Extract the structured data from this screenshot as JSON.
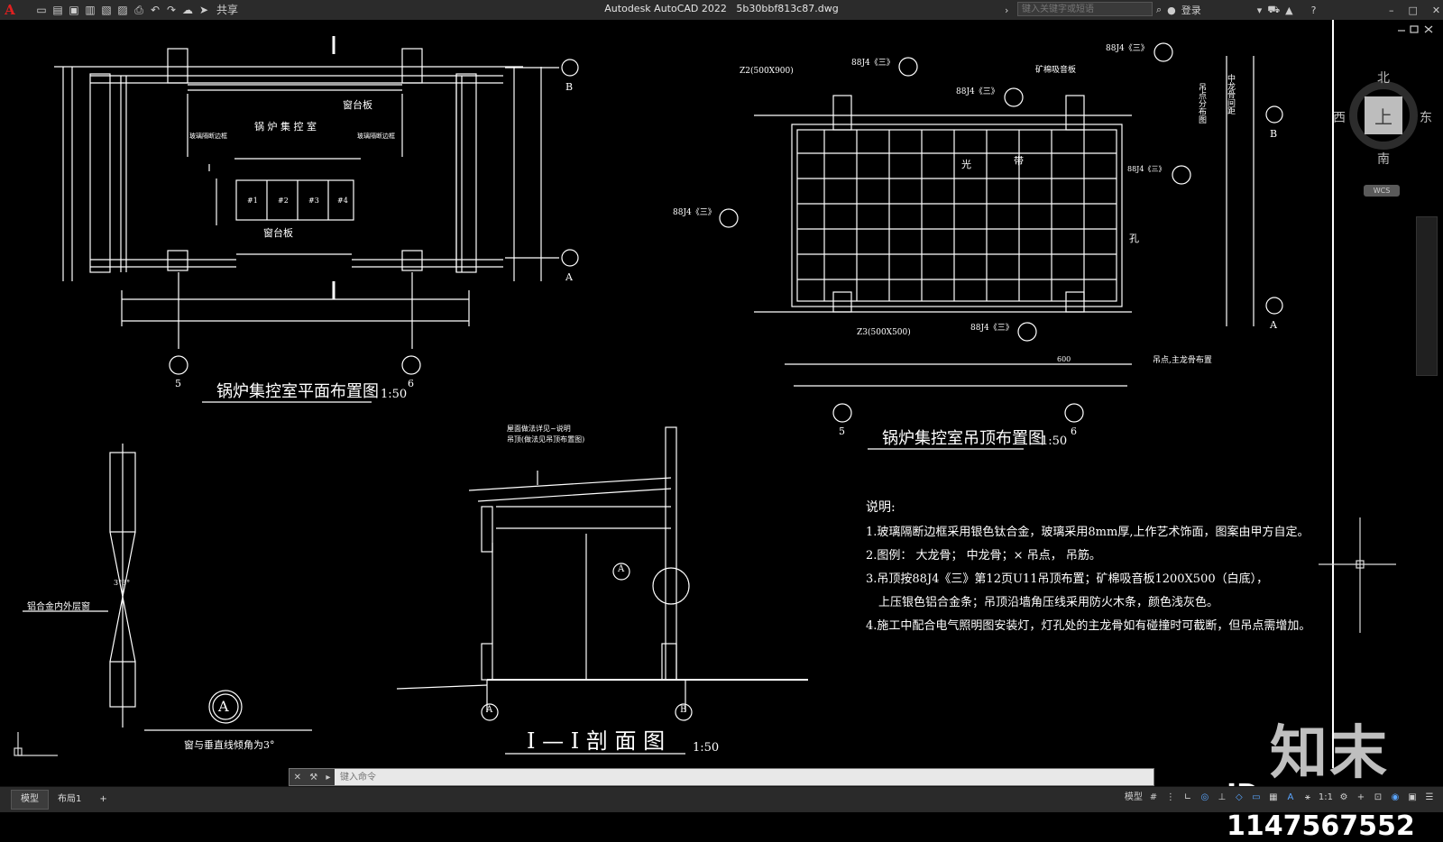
{
  "window": {
    "app_logo": "A",
    "title": "Autodesk AutoCAD 2022",
    "file": "5b30bbf813c87.dwg",
    "share": "共享",
    "search_placeholder": "键入关键字或短语",
    "login": "登录"
  },
  "viewcube": {
    "north": "北",
    "south": "南",
    "west": "西",
    "east": "东",
    "face": "上",
    "wcs": "WCS"
  },
  "drawings": {
    "plan": {
      "title": "锅炉集控室平面布置图",
      "scale": "1:50",
      "room": "锅 炉 集 控 室",
      "sill_top": "窗台板",
      "sill_bottom": "窗台板",
      "glass_left": "玻璃隔断边框",
      "glass_right": "玻璃隔断边框",
      "desks": [
        "#1",
        "#2",
        "#3",
        "#4"
      ],
      "axis_b": "B",
      "axis_a": "A",
      "axis_5": "5",
      "axis_6": "6"
    },
    "ceiling": {
      "title": "锅炉集控室吊顶布置图",
      "scale": "1:50",
      "z2": "Z2(500X900)",
      "z3": "Z3(500X500)",
      "tag1": "88J4《三》",
      "tag2": "88J4《三》",
      "tag3": "88J4《三》",
      "tag4": "88J4《三》",
      "tag5": "88J4《三》",
      "tag6": "88J4《三》",
      "board": "矿棉吸音板",
      "hole": "孔",
      "guang": "光",
      "dai": "带",
      "col1": "吊点分布图",
      "col2": "中龙骨间距",
      "dim_600": "600",
      "dim_note": "吊点,主龙骨布置",
      "axis_b": "B",
      "axis_a": "A",
      "axis_5": "5",
      "axis_6": "6"
    },
    "section": {
      "title": "I — I 剖 面 图",
      "scale": "1:50",
      "note1": "屋面做法详见~说明",
      "note2": "吊顶(做法见吊顶布置图)",
      "axis_a": "A",
      "axis_b": "B",
      "detail": "A"
    },
    "detail": {
      "label": "铝合金内外层窗",
      "angle": "3°3°",
      "circle": "A",
      "caption": "窗与垂直线倾角为3°"
    },
    "notes": {
      "heading": "说明:",
      "lines": [
        "1.玻璃隔断边框采用银色钛合金，玻璃采用8mm厚,上作艺术饰面，图案由甲方自定。",
        "2.图例：         大龙骨；        中龙骨；×  吊点，    吊筋。",
        "3.吊顶按88J4《三》第12页U11吊顶布置；矿棉吸音板1200X500（白底），",
        "上压银色铝合金条；吊顶沿墙角压线采用防火木条，颜色浅灰色。",
        "4.施工中配合电气照明图安装灯，灯孔处的主龙骨如有碰撞时可截断，但吊点需增加。"
      ]
    }
  },
  "watermark": {
    "brand": "知末",
    "id": "ID: 1147567552"
  },
  "command": {
    "placeholder": "键入命令"
  },
  "status": {
    "tabs": [
      "模型",
      "布局1"
    ],
    "add": "+",
    "model": "模型",
    "scale": "1:1"
  },
  "colors": {
    "cad_line": "#ffffff",
    "cad_bg": "#000000",
    "chrome": "#2b2b2b",
    "logo": "#e02020"
  }
}
